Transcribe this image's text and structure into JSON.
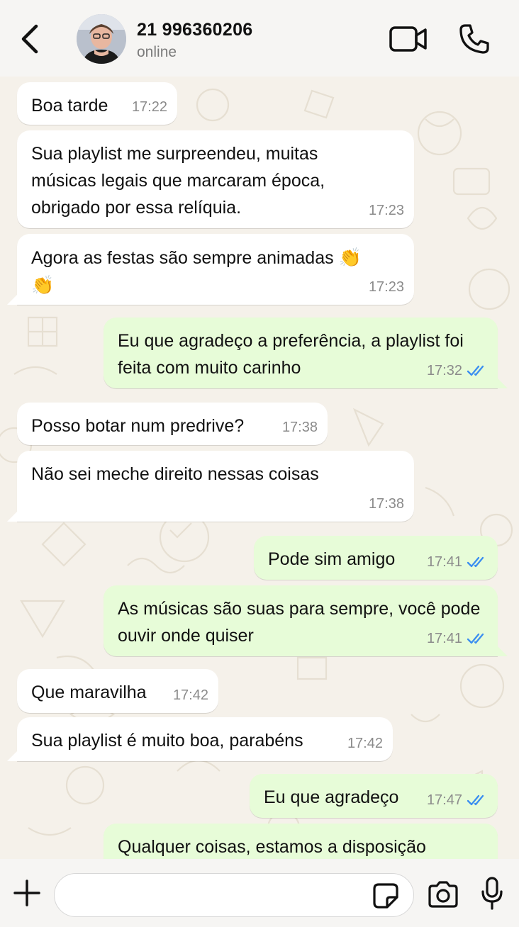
{
  "header": {
    "contact_name": "21 996360206",
    "status": "online",
    "icons": [
      "back-arrow-icon",
      "video-call-icon",
      "phone-call-icon"
    ]
  },
  "messages": [
    {
      "dir": "in",
      "text": "Boa tarde",
      "time": "17:22"
    },
    {
      "dir": "in",
      "text": "Sua playlist me surpreendeu, muitas músicas legais que marcaram época, obrigado por essa relíquia.",
      "time": "17:23"
    },
    {
      "dir": "in",
      "text": "Agora as festas são sempre animadas",
      "emoji": "👏",
      "time": "17:23"
    },
    {
      "dir": "out",
      "text": "Eu que agradeço a preferência, a playlist foi feita com muito carinho",
      "time": "17:32",
      "status": "read"
    },
    {
      "dir": "in",
      "text": "Posso botar num predrive?",
      "time": "17:38"
    },
    {
      "dir": "in",
      "text": "Não sei meche direito nessas coisas",
      "time": "17:38"
    },
    {
      "dir": "out",
      "text": "Pode sim amigo",
      "time": "17:41",
      "status": "read"
    },
    {
      "dir": "out",
      "text": "As músicas são suas para sempre, você pode ouvir onde quiser",
      "time": "17:41",
      "status": "read"
    },
    {
      "dir": "in",
      "text": "Que maravilha",
      "time": "17:42"
    },
    {
      "dir": "in",
      "text": "Sua playlist é muito boa, parabéns",
      "time": "17:42"
    },
    {
      "dir": "out",
      "text": "Eu que agradeço",
      "time": "17:47",
      "status": "read"
    },
    {
      "dir": "out",
      "text": "Qualquer coisas, estamos a disposição",
      "time": ""
    }
  ],
  "composer": {
    "placeholder": "",
    "icons": [
      "plus-icon",
      "sticker-icon",
      "camera-icon",
      "microphone-icon"
    ]
  },
  "colors": {
    "incoming_bubble": "#ffffff",
    "outgoing_bubble": "#e7fcd8",
    "read_ticks": "#3b8ef0",
    "wallpaper": "#f5f1ea"
  }
}
